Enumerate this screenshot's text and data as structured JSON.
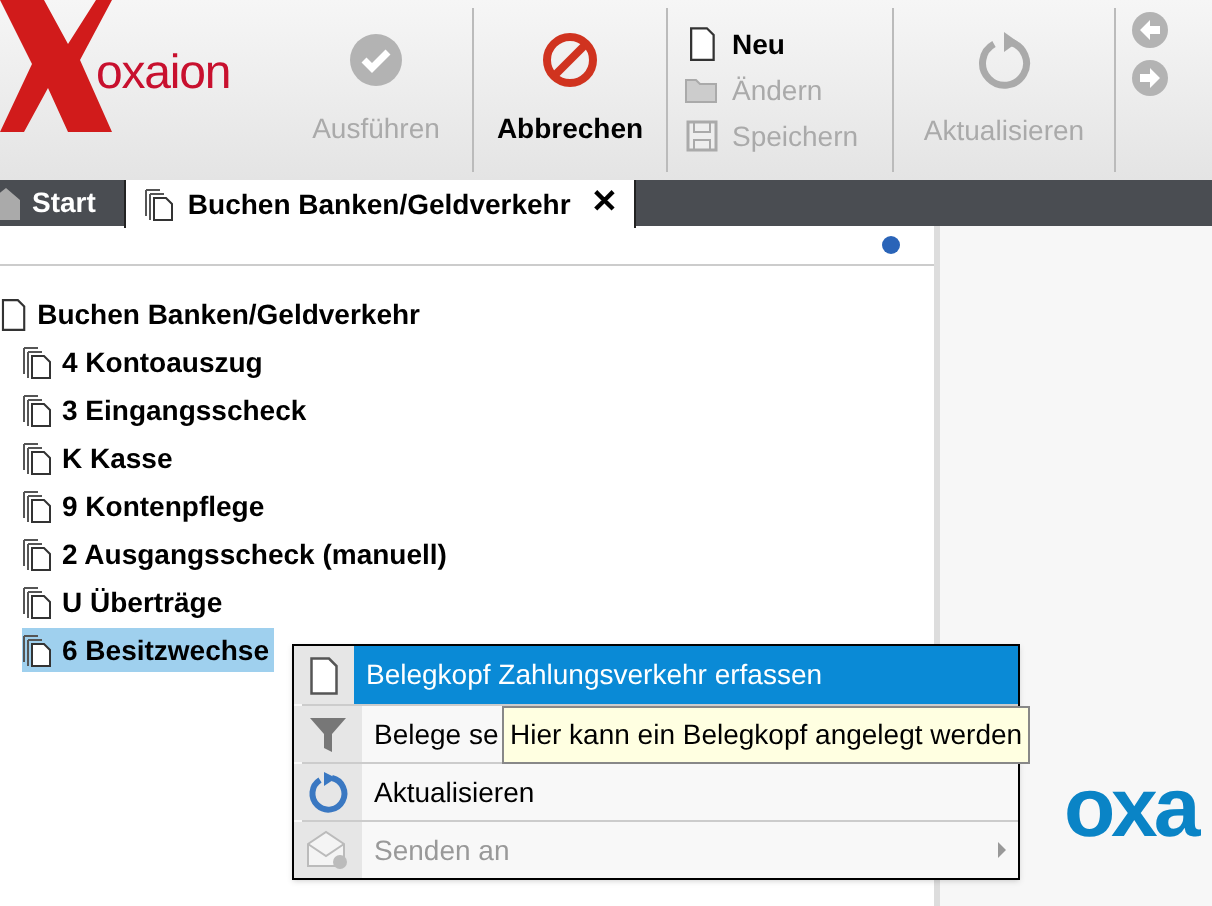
{
  "logo": {
    "text": "oxaion"
  },
  "toolbar": {
    "buttons": [
      {
        "kind": "run",
        "label": "Ausführen",
        "disabled": true
      },
      {
        "kind": "cancel",
        "label": "Abbrechen",
        "disabled": false
      }
    ],
    "record_actions": [
      {
        "kind": "new",
        "label": "Neu",
        "disabled": false
      },
      {
        "kind": "edit",
        "label": "Ändern",
        "disabled": true
      },
      {
        "kind": "save",
        "label": "Speichern",
        "disabled": true
      }
    ],
    "refresh": {
      "label": "Aktualisieren",
      "disabled": true
    }
  },
  "tabs": [
    {
      "label": "Start",
      "selected": false,
      "kind": "home"
    },
    {
      "label": "Buchen Banken/Geldverkehr",
      "selected": true,
      "kind": "doc",
      "close": "✕"
    }
  ],
  "tree": {
    "label": "Buchen Banken/Geldverkehr",
    "children": [
      {
        "label": "4 Kontoauszug",
        "selected": false
      },
      {
        "label": "3 Eingangsscheck",
        "selected": false
      },
      {
        "label": "K Kasse",
        "selected": false
      },
      {
        "label": "9 Kontenpflege",
        "selected": false
      },
      {
        "label": "2 Ausgangsscheck (manuell)",
        "selected": false
      },
      {
        "label": "U Überträge",
        "selected": false
      },
      {
        "label": "6 Besitzwechse",
        "selected": true
      }
    ]
  },
  "context_menu": [
    {
      "kind": "doc",
      "label": "Belegkopf Zahlungsverkehr erfassen",
      "selected": true,
      "disabled": false
    },
    {
      "kind": "filter",
      "label": "Belege se",
      "selected": false,
      "disabled": false
    },
    {
      "kind": "refresh",
      "label": "Aktualisieren",
      "selected": false,
      "disabled": false
    },
    {
      "kind": "send",
      "label": "Senden an",
      "selected": false,
      "disabled": true,
      "submenu": true
    }
  ],
  "tooltip": "Hier kann ein Belegkopf angelegt werden",
  "brand_text": "oxa"
}
